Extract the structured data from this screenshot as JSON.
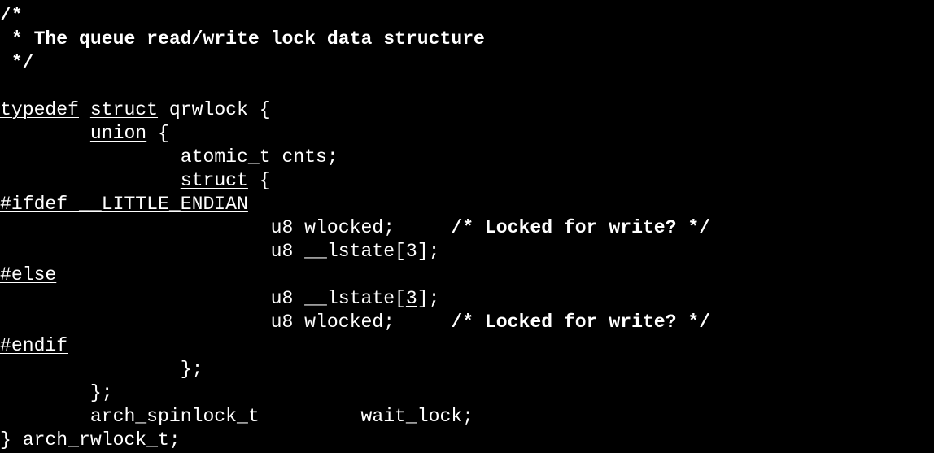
{
  "editor": {
    "background": "#000000",
    "foreground": "#ffffff",
    "lines": [
      [
        {
          "t": "/*",
          "s": "bold"
        }
      ],
      [
        {
          "t": " * The queue read/write lock data structure",
          "s": "bold"
        }
      ],
      [
        {
          "t": " */",
          "s": "bold"
        }
      ],
      [],
      [
        {
          "t": "typedef",
          "s": "ul"
        },
        {
          "t": " "
        },
        {
          "t": "struct",
          "s": "ul"
        },
        {
          "t": " qrwlock {"
        }
      ],
      [
        {
          "t": "        "
        },
        {
          "t": "union",
          "s": "ul"
        },
        {
          "t": " {"
        }
      ],
      [
        {
          "t": "                atomic_t cnts;"
        }
      ],
      [
        {
          "t": "                "
        },
        {
          "t": "struct",
          "s": "ul"
        },
        {
          "t": " {"
        }
      ],
      [
        {
          "t": "#ifdef __LITTLE_ENDIAN",
          "s": "ul"
        }
      ],
      [
        {
          "t": "                        u8 wlocked;     "
        },
        {
          "t": "/* Locked for write? */",
          "s": "bold"
        }
      ],
      [
        {
          "t": "                        u8 __lstate["
        },
        {
          "t": "3",
          "s": "ul"
        },
        {
          "t": "];"
        }
      ],
      [
        {
          "t": "#else",
          "s": "ul"
        }
      ],
      [
        {
          "t": "                        u8 __lstate["
        },
        {
          "t": "3",
          "s": "ul"
        },
        {
          "t": "];"
        }
      ],
      [
        {
          "t": "                        u8 wlocked;     "
        },
        {
          "t": "/* Locked for write? */",
          "s": "bold"
        }
      ],
      [
        {
          "t": "#endif",
          "s": "ul"
        }
      ],
      [
        {
          "t": "                };"
        }
      ],
      [
        {
          "t": "        };"
        }
      ],
      [
        {
          "t": "        arch_spinlock_t         wait_lock;"
        }
      ],
      [
        {
          "t": "} arch_rwlock_t;"
        }
      ]
    ]
  }
}
